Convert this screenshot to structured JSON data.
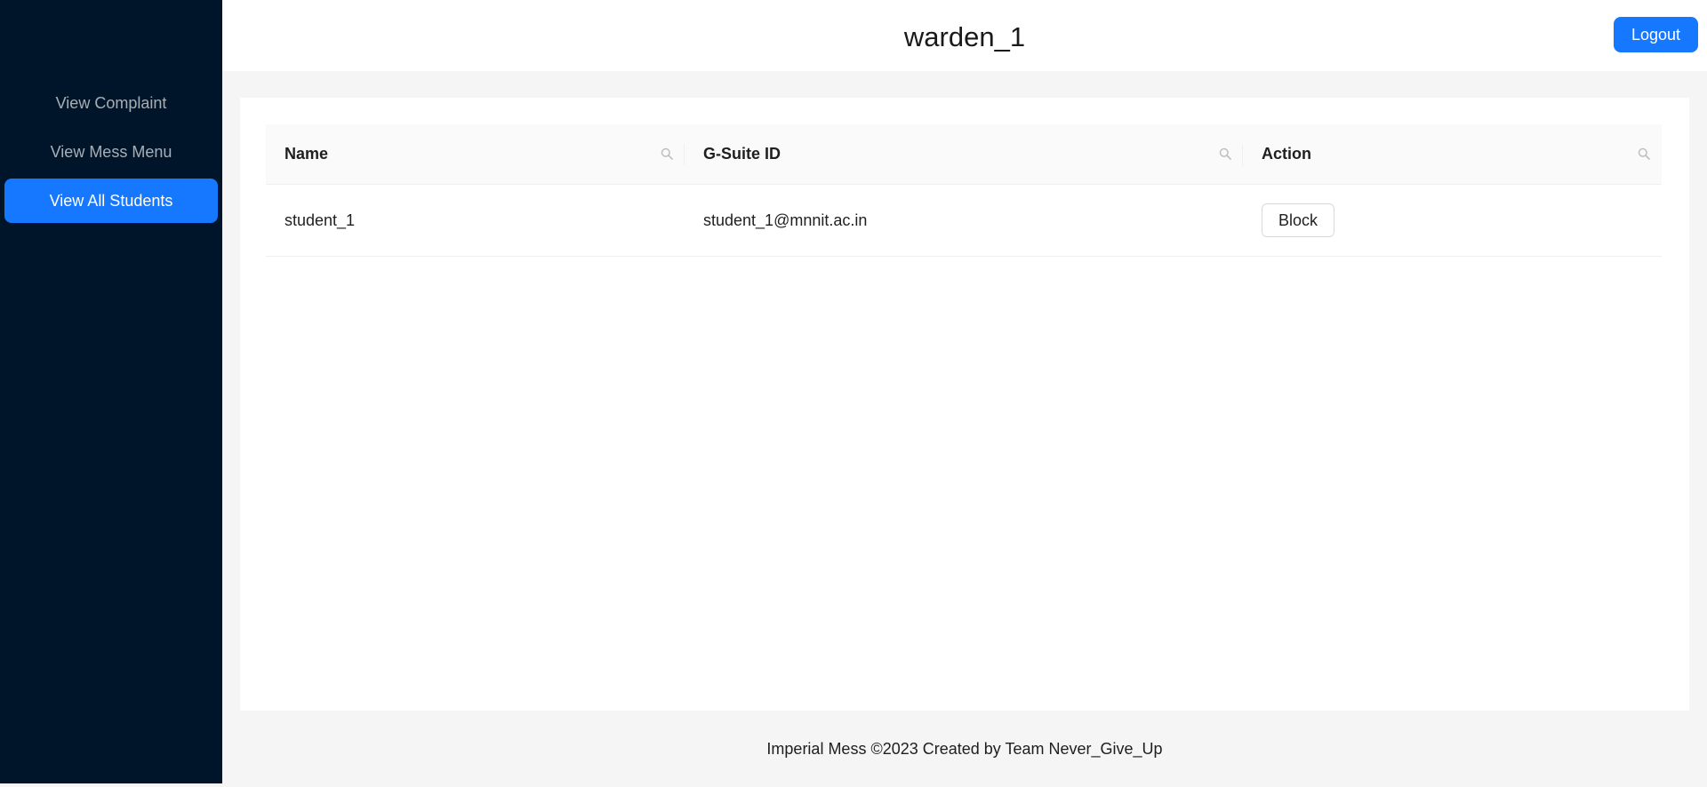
{
  "sidebar": {
    "items": [
      {
        "label": "View Complaint",
        "selected": false
      },
      {
        "label": "View Mess Menu",
        "selected": false
      },
      {
        "label": "View All Students",
        "selected": true
      }
    ]
  },
  "header": {
    "title": "warden_1",
    "logout_label": "Logout"
  },
  "table": {
    "columns": [
      {
        "label": "Name",
        "icon": "search-icon"
      },
      {
        "label": "G-Suite ID",
        "icon": "search-icon"
      },
      {
        "label": "Action",
        "icon": "search-icon"
      }
    ],
    "rows": [
      {
        "name": "student_1",
        "gsuite_id": "student_1@mnnit.ac.in",
        "action_label": "Block"
      }
    ]
  },
  "footer": {
    "text": "Imperial Mess ©2023 Created by Team Never_Give_Up"
  },
  "colors": {
    "sidebar_bg": "#001529",
    "accent": "#1677ff",
    "page_bg": "#f5f5f5"
  }
}
